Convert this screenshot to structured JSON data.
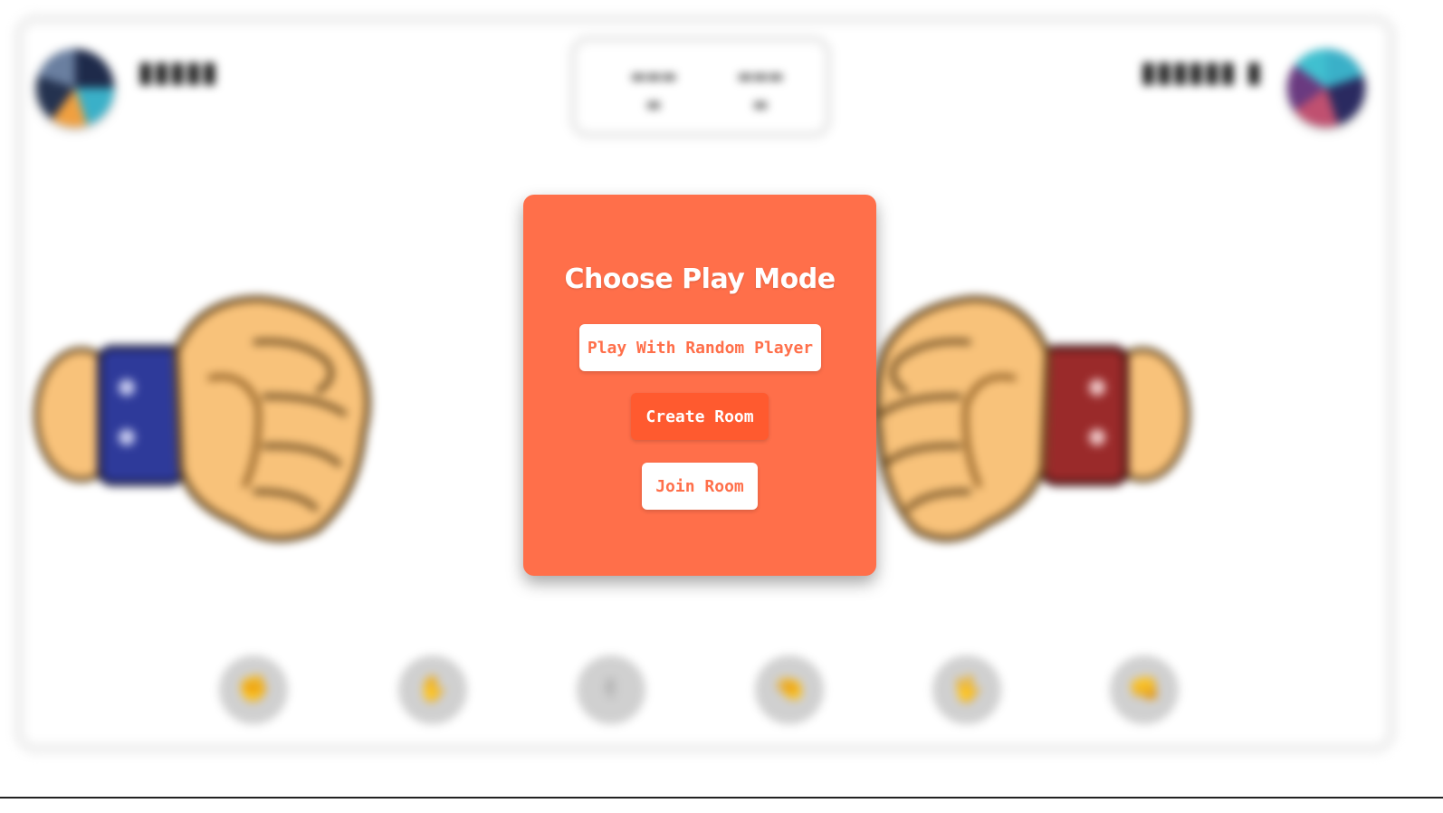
{
  "modal": {
    "title": "Choose Play Mode",
    "buttons": {
      "random": "Play With Random Player",
      "create": "Create Room",
      "join": "Join Room"
    }
  },
  "background": {
    "choices": [
      {
        "icon": "rock-icon",
        "glyph": "✊"
      },
      {
        "icon": "paper-icon",
        "glyph": "✋"
      },
      {
        "icon": "scissors-icon",
        "glyph": "✌"
      },
      {
        "icon": "lizard-icon",
        "glyph": "🤏"
      },
      {
        "icon": "spock-icon",
        "glyph": "🖖"
      },
      {
        "icon": "fist-icon",
        "glyph": "👊"
      }
    ]
  },
  "colors": {
    "modal": "#ff6f4a",
    "create_button": "#ff5a2f",
    "left_wristband": "#2e3a9a",
    "right_wristband": "#9a2a2a",
    "skin": "#f8c27a"
  }
}
